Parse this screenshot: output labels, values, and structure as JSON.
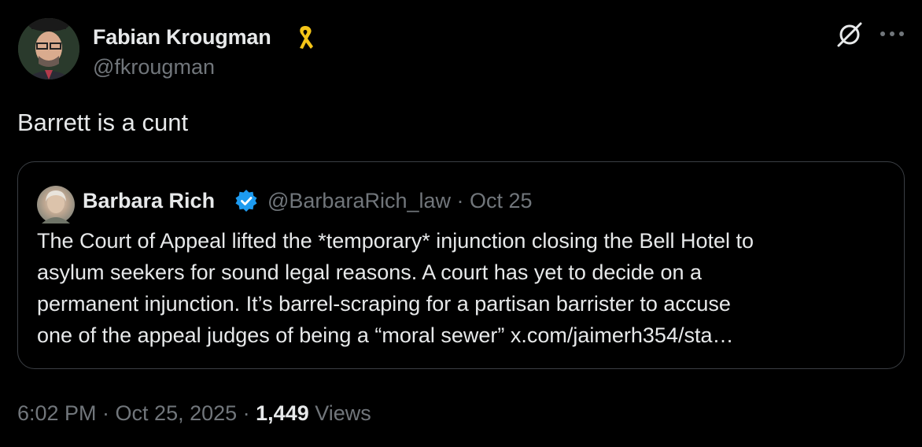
{
  "author": {
    "display_name": "Fabian Krougman",
    "handle": "@fkrougman",
    "badge_icon": "yellow-ribbon-icon"
  },
  "tweet": {
    "text": "Barrett is a cunt"
  },
  "quoted_tweet": {
    "display_name": "Barbara Rich",
    "verified_icon": "verified-badge-icon",
    "handle_and_date": "@BarbaraRich_law · Oct 25",
    "lines": [
      "The Court of Appeal lifted the *temporary* injunction closing the Bell Hotel to",
      "asylum seekers for sound legal reasons. A court has yet to decide on a",
      "permanent injunction. It’s barrel-scraping for a partisan barrister to accuse",
      "one of the appeal judges of being a “moral sewer” x.com/jaimerh354/sta…"
    ]
  },
  "meta": {
    "timestamp": "6:02 PM · Oct 25, 2025 · ",
    "view_count": "1,449",
    "views_label": " Views"
  },
  "colors": {
    "background": "#000000",
    "text": "#e7e9ea",
    "secondary": "#71767b",
    "verified": "#1d9bf0",
    "ribbon": "#f5c518"
  }
}
